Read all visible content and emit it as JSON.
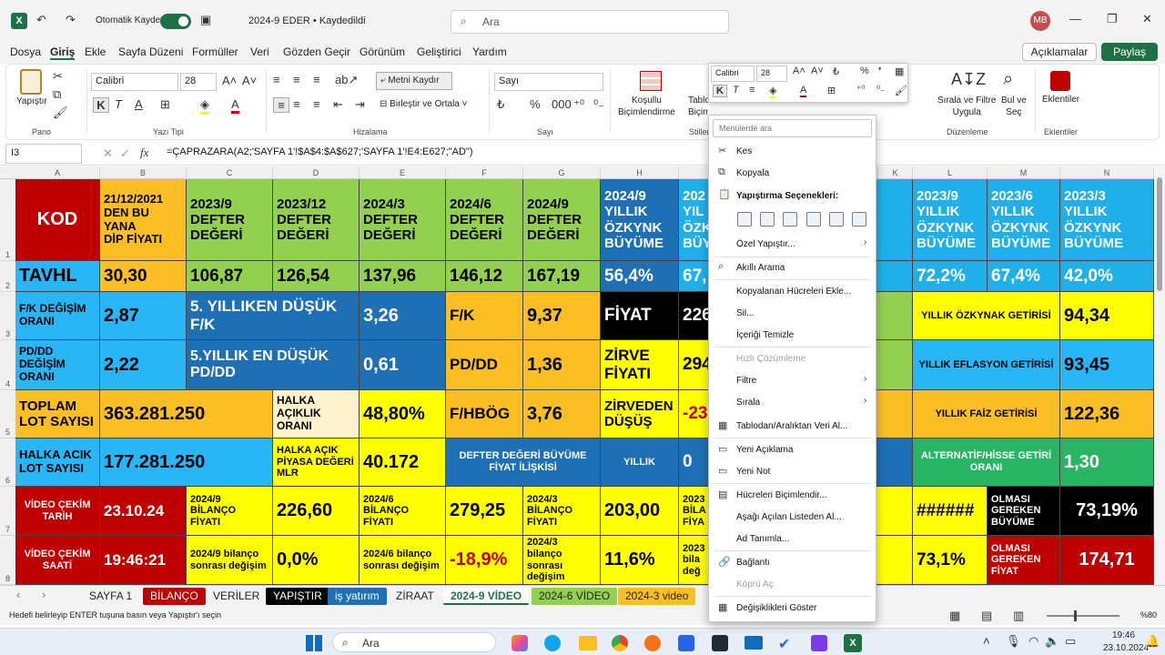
{
  "titlebar": {
    "autosave_label": "Otomatik Kaydet",
    "doc_title": "2024-9 EDER • Kaydedildi",
    "search_placeholder": "Ara",
    "avatar": "MB"
  },
  "menu": [
    "Dosya",
    "Giriş",
    "Ekle",
    "Sayfa Düzeni",
    "Formüller",
    "Veri",
    "Gözden Geçir",
    "Görünüm",
    "Geliştirici",
    "Yardım"
  ],
  "comments_btn": "Açıklamalar",
  "share_btn": "Paylaş",
  "ribbon": {
    "paste": "Yapıştır",
    "font": "Calibri",
    "size": "28",
    "wrap": "Metni Kaydır",
    "merge": "Birleştir ve Ortala",
    "numfmt": "Sayı",
    "cond_format": "Koşullu\nBiçimlendirme",
    "table_format": "Tablo\nBiçimlendir",
    "cell_styles": "Stilleri",
    "sort": "Sırala ve Filtre\nUygula",
    "find": "Bul ve\nSeç",
    "addins": "Eklentiler",
    "groups": {
      "clipboard": "Pano",
      "font": "Yazı Tipi",
      "align": "Hizalama",
      "number": "Sayı",
      "styles": "Stiller",
      "editing": "Düzenleme",
      "addins": "Eklentiler"
    }
  },
  "namebox": "I3",
  "formula": "=ÇAPRAZARA(A2;'SAYFA 1'!$A$4:$A$627;'SAYFA 1'!E4:E627;\"AD\")",
  "columns": [
    "A",
    "B",
    "C",
    "D",
    "E",
    "F",
    "G",
    "H",
    "I",
    "J",
    "K",
    "L",
    "M",
    "N"
  ],
  "rows": [
    "1",
    "2",
    "3",
    "4",
    "5",
    "6",
    "7",
    "8"
  ],
  "cells": {
    "r1": [
      "KOD",
      "21/12/2021\nDEN BU YANA\nDİP FİYATI",
      "2023/9\nDEFTER\nDEĞERİ",
      "2023/12\nDEFTER\nDEĞERİ",
      "2024/3\nDEFTER\nDEĞERİ",
      "2024/6\nDEFTER\nDEĞERİ",
      "2024/9\nDEFTER\nDEĞERİ",
      "2024/9\nYILLIK\nÖZKYNK\nBÜYÜME",
      "202\nYIL\nÖZK\nBÜY",
      "/12\nYIL\nME",
      "2023/9\nYILLIK\nÖZKYNK\nBÜYÜME",
      "2023/6\nYILLIK\nÖZKYNK\nBÜYÜME",
      "2023/3\nYILLIK\nÖZKYNK\nBÜYÜME"
    ],
    "r2": [
      "TAVHL",
      "30,30",
      "106,87",
      "126,54",
      "137,96",
      "146,12",
      "167,19",
      "56,4%",
      "67,",
      "%",
      "72,2%",
      "67,4%",
      "42,0%"
    ],
    "r3": [
      "F/K DEĞİŞİM\nORANI",
      "2,87",
      "5. YILLIKEN DÜŞÜK F/K",
      "3,26",
      "F/K",
      "9,37",
      "FİYAT",
      "226",
      "%",
      "YILLIK ÖZKYNAK GETİRİSİ",
      "94,34"
    ],
    "r4": [
      "PD/DD\nDEĞİŞİM\nORANI",
      "2,22",
      "5.YILLIK EN DÜŞÜK\nPD/DD",
      "0,61",
      "PD/DD",
      "1,36",
      "ZİRVE\nFİYATI",
      "294",
      "4%",
      "YILLIK EFLASYON  GETİRİSİ",
      "93,45"
    ],
    "r5": [
      "TOPLAM\nLOT SAYISI",
      "363.281.250",
      "HALKA\nAÇIKLIK\nORANI",
      "48,80%",
      "F/HBÖG",
      "3,76",
      "ZİRVEDEN\nDÜŞÜŞ",
      "-23",
      "0%",
      "YILLIK FAİZ  GETİRİSİ",
      "122,36"
    ],
    "r6": [
      "HALKA ACIK\nLOT SAYISI",
      "177.281.250",
      "HALKA AÇIK\nPİYASA DEĞERİ\nMLR",
      "40.172",
      "DEFTER DEĞERİ BÜYÜME\nFİYAT İLİŞKİSİ",
      "YILLIK",
      "0",
      "2",
      "ALTERNATİF/HİSSE  GETİRİ\nORANI",
      "1,30"
    ],
    "r7": [
      "VİDEO ÇEKİM\nTARİH",
      "23.10.24",
      "2024/9\nBİLANÇO FİYATI",
      "226,60",
      "2024/6\nBİLANÇO FİYATI",
      "279,25",
      "2024/3\nBİLANÇO\nFİYATI",
      "203,00",
      "2023\nBİLA\nFİYA",
      "0",
      "######",
      "OLMASI\nGEREKEN\nBÜYÜME",
      "73,19%"
    ],
    "r8": [
      "VİDEO ÇEKİM\nSAATİ",
      "19:46:21",
      "2024/9 bilanço\nsonrası değişim",
      "0,0%",
      "2024/6 bilanço\nsonrası değişim",
      "-18,9%",
      "2024/3\nbilanço sonrası\ndeğişim",
      "11,6%",
      "2023\nbila\ndeğ",
      "9\nsonrası",
      "73,1%",
      "OLMASI\nGEREKEN\nFİYAT",
      "174,71"
    ]
  },
  "sheet_tabs": [
    {
      "label": "SAYFA 1",
      "bg": "#f3f3f3",
      "fg": "#222"
    },
    {
      "label": "BİLANÇO",
      "bg": "#c00000",
      "fg": "#fff"
    },
    {
      "label": "VERİLER",
      "bg": "#f3f3f3",
      "fg": "#222"
    },
    {
      "label": "YAPIŞTIR",
      "bg": "#000000",
      "fg": "#fff"
    },
    {
      "label": "iş yatırım",
      "bg": "#1f6fb5",
      "fg": "#fff"
    },
    {
      "label": "ZİRAAT",
      "bg": "#f3f3f3",
      "fg": "#222"
    },
    {
      "label": "2024-9 VİDEO",
      "bg": "#ffffff",
      "fg": "#1e7145"
    },
    {
      "label": "2024-6 VİDEO",
      "bg": "#92d050",
      "fg": "#222"
    },
    {
      "label": "2024-3 video",
      "bg": "#fbbf24",
      "fg": "#222"
    }
  ],
  "status": {
    "message": "Hedefi belirleyip ENTER tuşuna basın veya Yapıştır'ı seçin",
    "zoom": "%80"
  },
  "taskbar": {
    "search": "Ara",
    "time": "19:46",
    "date": "23.10.2024"
  },
  "minitb": {
    "font": "Calibri",
    "size": "28"
  },
  "context_menu": {
    "search_placeholder": "Menülerde ara",
    "items": {
      "cut": "Kes",
      "copy": "Kopyala",
      "paste_options": "Yapıştırma Seçenekleri:",
      "paste_special": "Özel Yapıştır...",
      "smart_lookup": "Akıllı Arama",
      "insert_copied": "Kopyalanan Hücreleri Ekle...",
      "delete": "Sil...",
      "clear": "İçeriği Temizle",
      "quick_analysis": "Hızlı Çözümleme",
      "filter": "Filtre",
      "sort": "Sırala",
      "table_range": "Tablodan/Aralıktan Veri Al...",
      "new_comment": "Yeni Açıklama",
      "new_note": "Yeni Not",
      "format_cells": "Hücreleri Biçimlendir...",
      "pick_list": "Aşağı Açılan Listeden Al...",
      "define_name": "Ad Tanımla...",
      "link": "Bağlantı",
      "copy_link": "Köprü Aç",
      "show_changes": "Değişiklikleri Göster"
    }
  }
}
